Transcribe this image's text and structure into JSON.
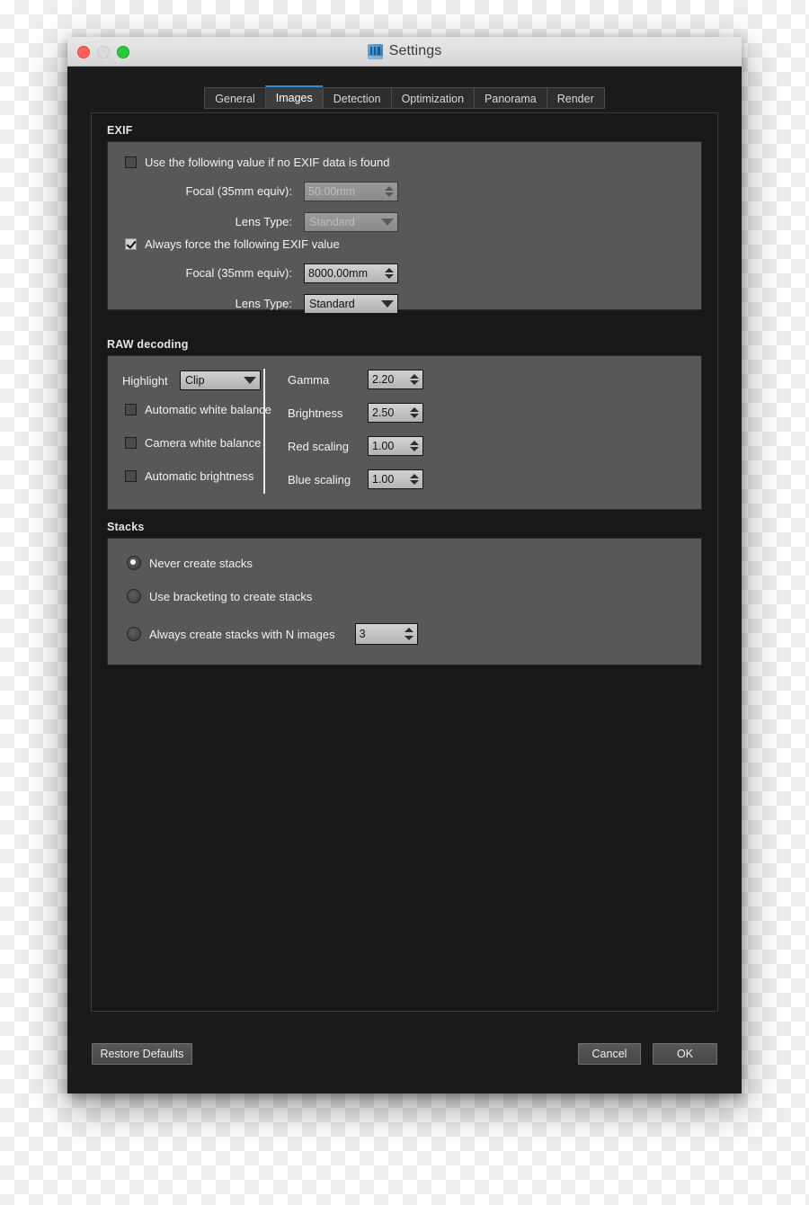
{
  "window": {
    "title": "Settings",
    "app_icon": "app-icon",
    "traffic_lights": [
      "close-button",
      "minimize-button",
      "zoom-button"
    ]
  },
  "tabs": [
    {
      "label": "General",
      "active": false
    },
    {
      "label": "Images",
      "active": true
    },
    {
      "label": "Detection",
      "active": false
    },
    {
      "label": "Optimization",
      "active": false
    },
    {
      "label": "Panorama",
      "active": false
    },
    {
      "label": "Render",
      "active": false
    }
  ],
  "exif": {
    "section_title": "EXIF",
    "use_default_checkbox": {
      "label": "Use the following value if no EXIF data is found",
      "checked": false
    },
    "default_focal": {
      "label": "Focal (35mm equiv):",
      "value": "50.00mm",
      "enabled": false
    },
    "default_lens": {
      "label": "Lens Type:",
      "value": "Standard",
      "enabled": false
    },
    "force_checkbox": {
      "label": "Always force the following EXIF value",
      "checked": true
    },
    "force_focal": {
      "label": "Focal (35mm equiv):",
      "value": "8000.00mm",
      "enabled": true
    },
    "force_lens": {
      "label": "Lens Type:",
      "value": "Standard",
      "enabled": true
    }
  },
  "raw": {
    "section_title": "RAW decoding",
    "highlight": {
      "label": "Highlight",
      "value": "Clip"
    },
    "auto_white_balance": {
      "label": "Automatic white balance",
      "checked": false
    },
    "camera_white_balance": {
      "label": "Camera white balance",
      "checked": false
    },
    "auto_brightness": {
      "label": "Automatic brightness",
      "checked": false
    },
    "gamma": {
      "label": "Gamma",
      "value": "2.20"
    },
    "brightness": {
      "label": "Brightness",
      "value": "2.50"
    },
    "red_scaling": {
      "label": "Red scaling",
      "value": "1.00"
    },
    "blue_scaling": {
      "label": "Blue scaling",
      "value": "1.00"
    }
  },
  "stacks": {
    "section_title": "Stacks",
    "options": [
      {
        "label": "Never create stacks",
        "selected": true
      },
      {
        "label": "Use bracketing to create stacks",
        "selected": false
      },
      {
        "label": "Always create stacks with N images",
        "selected": false
      }
    ],
    "n_images": "3"
  },
  "footer": {
    "restore_defaults": "Restore Defaults",
    "cancel": "Cancel",
    "ok": "OK"
  },
  "colors": {
    "accent": "#2b8fe0",
    "window_bg": "#1b1b1b",
    "panel_bg": "#585858",
    "content_bg": "#181818",
    "close": "#ff6058",
    "minimize": "#dcdcdc",
    "zoom": "#28c940"
  }
}
